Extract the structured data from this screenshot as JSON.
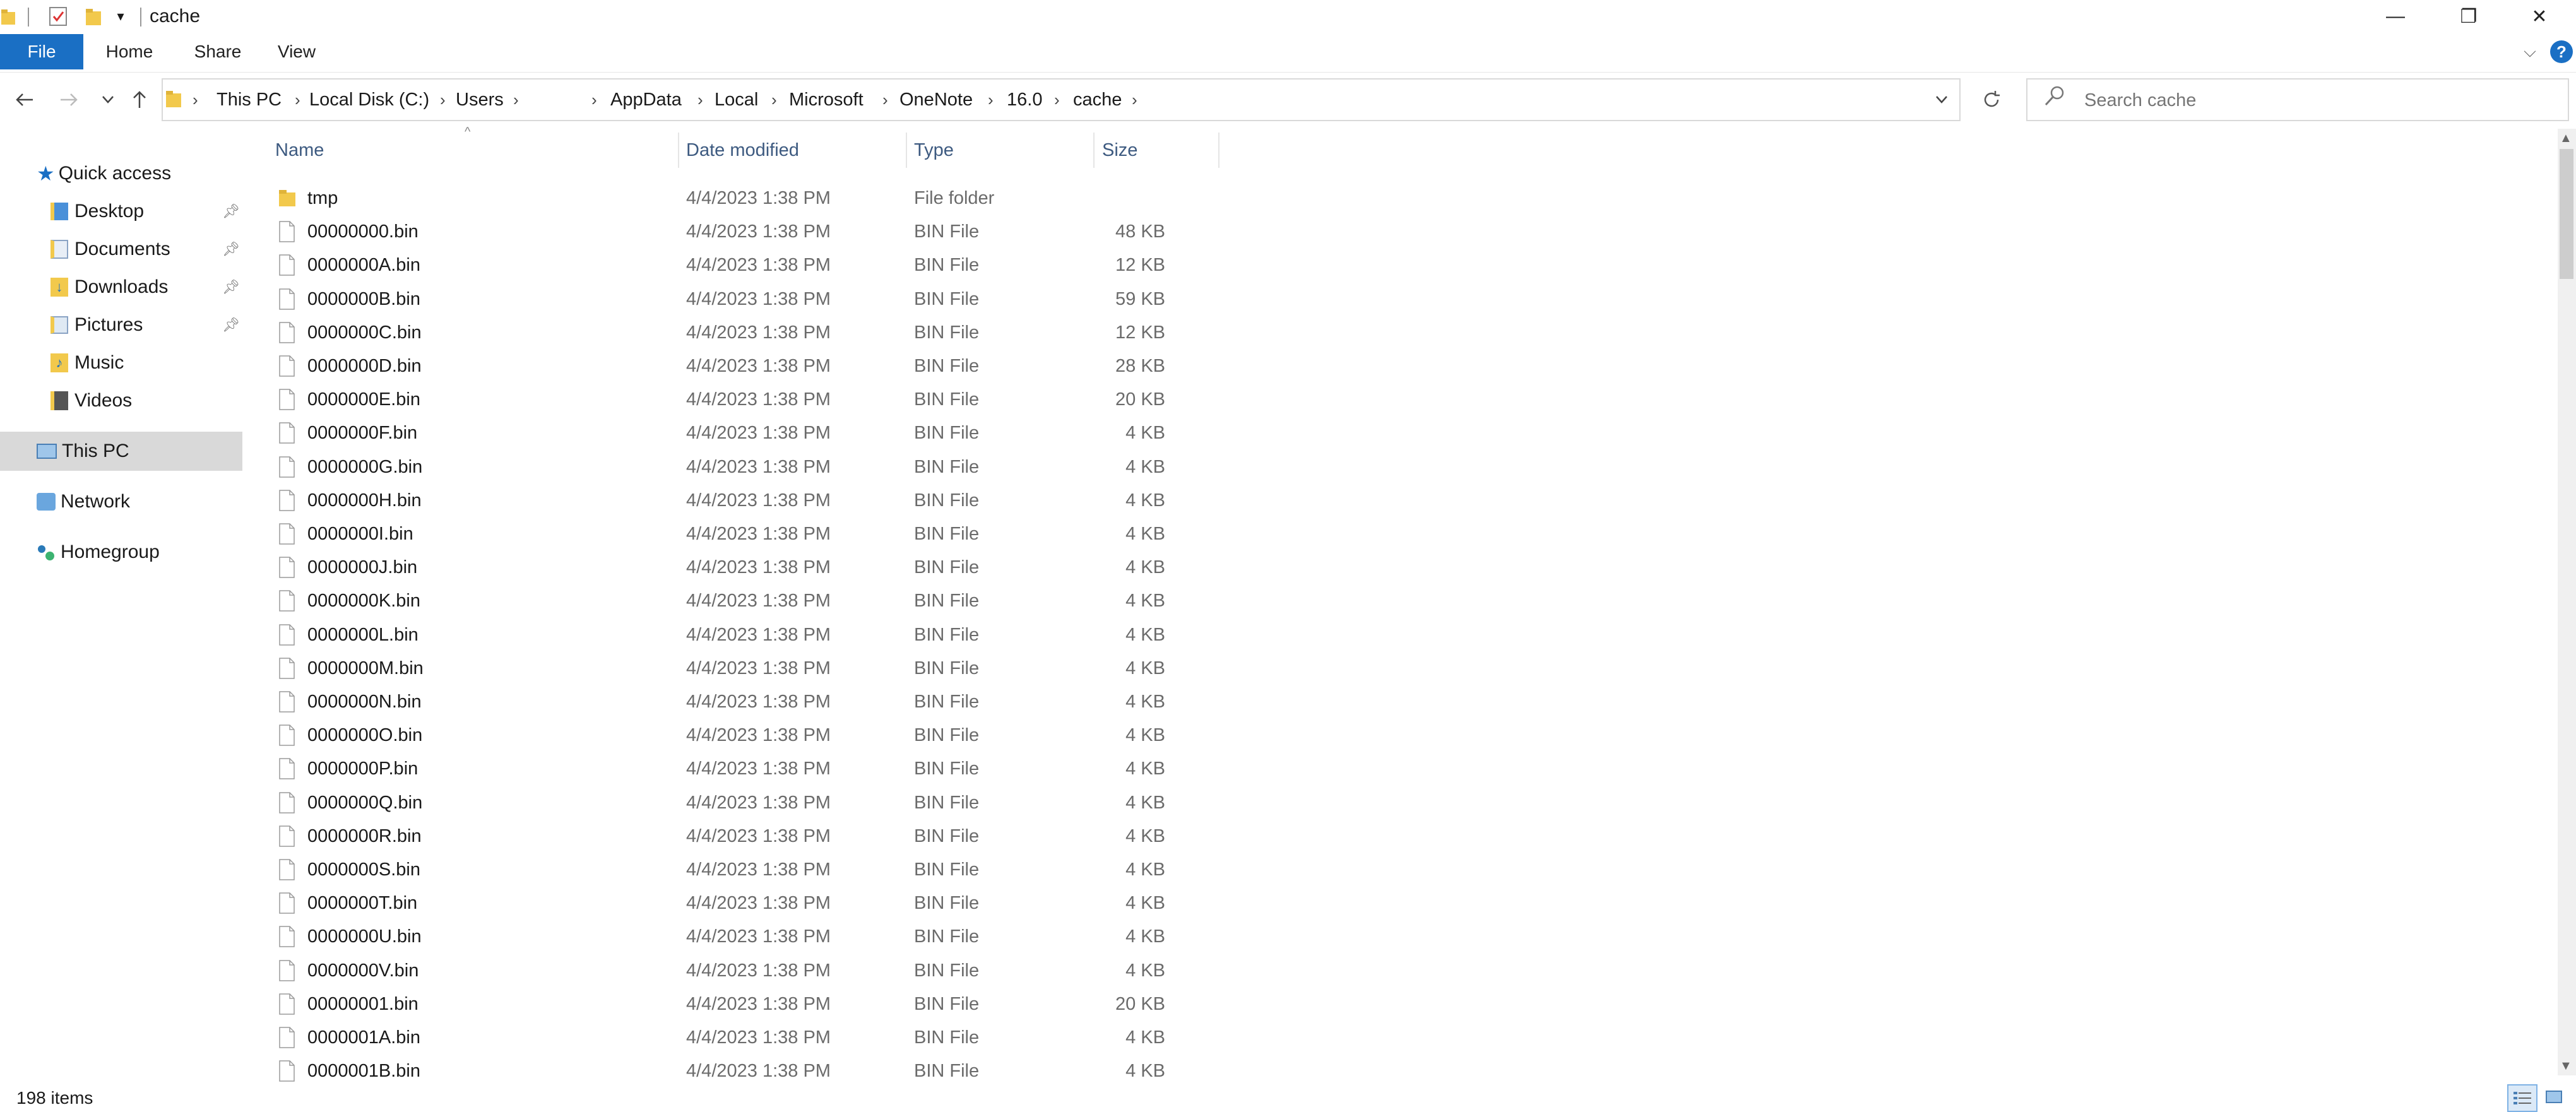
{
  "window": {
    "title": "cache",
    "minimize_glyph": "—",
    "restore_glyph": "❐",
    "close_glyph": "✕"
  },
  "ribbon": {
    "tabs": [
      "File",
      "Home",
      "Share",
      "View"
    ],
    "file_bg": "#1a6fc4"
  },
  "address": {
    "crumbs": [
      "This PC",
      "Local Disk (C:)",
      "Users",
      "",
      "AppData",
      "Local",
      "Microsoft",
      "OneNote",
      "16.0",
      "cache"
    ]
  },
  "search": {
    "placeholder": "Search cache"
  },
  "nav_pane": {
    "quick_access": "Quick access",
    "pinned": [
      "Desktop",
      "Documents",
      "Downloads",
      "Pictures"
    ],
    "unpinned": [
      "Music",
      "Videos"
    ],
    "this_pc": "This PC",
    "network": "Network",
    "homegroup": "Homegroup"
  },
  "columns": {
    "name": "Name",
    "date": "Date modified",
    "type": "Type",
    "size": "Size"
  },
  "files": [
    {
      "name": "tmp",
      "date": "4/4/2023 1:38 PM",
      "type": "File folder",
      "size": "",
      "icon": "folder-icon"
    },
    {
      "name": "00000000.bin",
      "date": "4/4/2023 1:38 PM",
      "type": "BIN File",
      "size": "48 KB",
      "icon": "file-icon"
    },
    {
      "name": "0000000A.bin",
      "date": "4/4/2023 1:38 PM",
      "type": "BIN File",
      "size": "12 KB",
      "icon": "file-icon"
    },
    {
      "name": "0000000B.bin",
      "date": "4/4/2023 1:38 PM",
      "type": "BIN File",
      "size": "59 KB",
      "icon": "file-icon"
    },
    {
      "name": "0000000C.bin",
      "date": "4/4/2023 1:38 PM",
      "type": "BIN File",
      "size": "12 KB",
      "icon": "file-icon"
    },
    {
      "name": "0000000D.bin",
      "date": "4/4/2023 1:38 PM",
      "type": "BIN File",
      "size": "28 KB",
      "icon": "file-icon"
    },
    {
      "name": "0000000E.bin",
      "date": "4/4/2023 1:38 PM",
      "type": "BIN File",
      "size": "20 KB",
      "icon": "file-icon"
    },
    {
      "name": "0000000F.bin",
      "date": "4/4/2023 1:38 PM",
      "type": "BIN File",
      "size": "4 KB",
      "icon": "file-icon"
    },
    {
      "name": "0000000G.bin",
      "date": "4/4/2023 1:38 PM",
      "type": "BIN File",
      "size": "4 KB",
      "icon": "file-icon"
    },
    {
      "name": "0000000H.bin",
      "date": "4/4/2023 1:38 PM",
      "type": "BIN File",
      "size": "4 KB",
      "icon": "file-icon"
    },
    {
      "name": "0000000I.bin",
      "date": "4/4/2023 1:38 PM",
      "type": "BIN File",
      "size": "4 KB",
      "icon": "file-icon"
    },
    {
      "name": "0000000J.bin",
      "date": "4/4/2023 1:38 PM",
      "type": "BIN File",
      "size": "4 KB",
      "icon": "file-icon"
    },
    {
      "name": "0000000K.bin",
      "date": "4/4/2023 1:38 PM",
      "type": "BIN File",
      "size": "4 KB",
      "icon": "file-icon"
    },
    {
      "name": "0000000L.bin",
      "date": "4/4/2023 1:38 PM",
      "type": "BIN File",
      "size": "4 KB",
      "icon": "file-icon"
    },
    {
      "name": "0000000M.bin",
      "date": "4/4/2023 1:38 PM",
      "type": "BIN File",
      "size": "4 KB",
      "icon": "file-icon"
    },
    {
      "name": "0000000N.bin",
      "date": "4/4/2023 1:38 PM",
      "type": "BIN File",
      "size": "4 KB",
      "icon": "file-icon"
    },
    {
      "name": "0000000O.bin",
      "date": "4/4/2023 1:38 PM",
      "type": "BIN File",
      "size": "4 KB",
      "icon": "file-icon"
    },
    {
      "name": "0000000P.bin",
      "date": "4/4/2023 1:38 PM",
      "type": "BIN File",
      "size": "4 KB",
      "icon": "file-icon"
    },
    {
      "name": "0000000Q.bin",
      "date": "4/4/2023 1:38 PM",
      "type": "BIN File",
      "size": "4 KB",
      "icon": "file-icon"
    },
    {
      "name": "0000000R.bin",
      "date": "4/4/2023 1:38 PM",
      "type": "BIN File",
      "size": "4 KB",
      "icon": "file-icon"
    },
    {
      "name": "0000000S.bin",
      "date": "4/4/2023 1:38 PM",
      "type": "BIN File",
      "size": "4 KB",
      "icon": "file-icon"
    },
    {
      "name": "0000000T.bin",
      "date": "4/4/2023 1:38 PM",
      "type": "BIN File",
      "size": "4 KB",
      "icon": "file-icon"
    },
    {
      "name": "0000000U.bin",
      "date": "4/4/2023 1:38 PM",
      "type": "BIN File",
      "size": "4 KB",
      "icon": "file-icon"
    },
    {
      "name": "0000000V.bin",
      "date": "4/4/2023 1:38 PM",
      "type": "BIN File",
      "size": "4 KB",
      "icon": "file-icon"
    },
    {
      "name": "00000001.bin",
      "date": "4/4/2023 1:38 PM",
      "type": "BIN File",
      "size": "20 KB",
      "icon": "file-icon"
    },
    {
      "name": "0000001A.bin",
      "date": "4/4/2023 1:38 PM",
      "type": "BIN File",
      "size": "4 KB",
      "icon": "file-icon"
    },
    {
      "name": "0000001B.bin",
      "date": "4/4/2023 1:38 PM",
      "type": "BIN File",
      "size": "4 KB",
      "icon": "file-icon"
    }
  ],
  "status": {
    "item_count": "198 items"
  }
}
